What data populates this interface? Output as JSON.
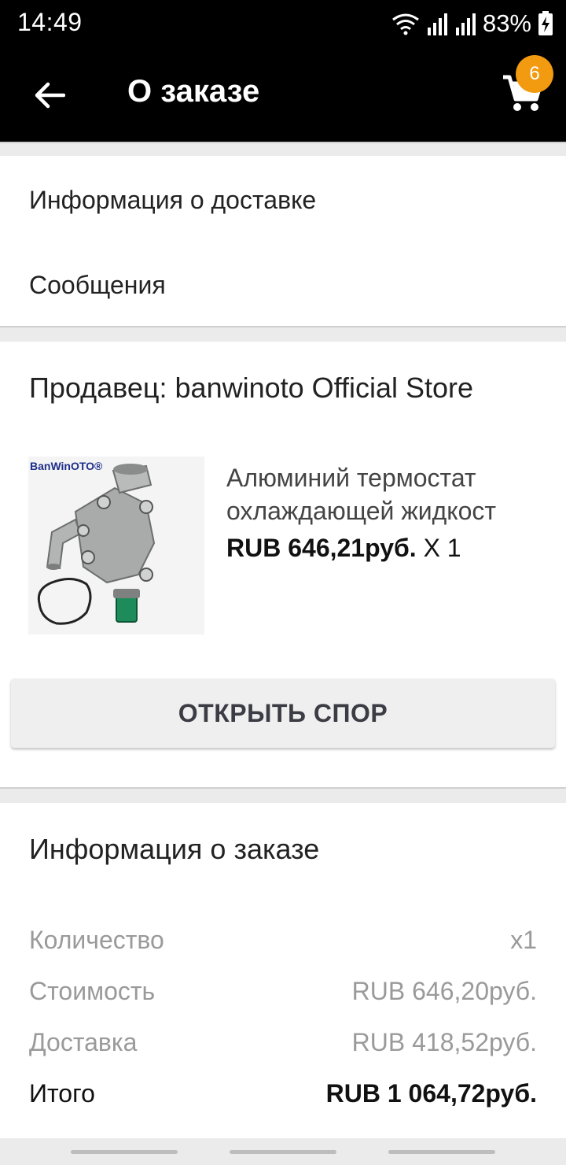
{
  "status_bar": {
    "time": "14:49",
    "battery": "83%",
    "icons": [
      "wifi-icon",
      "signal-icon",
      "signal-icon",
      "battery-charging-icon"
    ]
  },
  "app_bar": {
    "title": "О заказе",
    "back_icon": "arrow-left-icon",
    "cart_icon": "cart-icon",
    "cart_count": "6",
    "badge_color": "#f29a10"
  },
  "links": {
    "delivery_info": "Информация о доставке",
    "messages": "Сообщения"
  },
  "seller": {
    "label": "Продавец: banwinoto Official Store",
    "product": {
      "image_brand": "BanWinOTO®",
      "title_line1": "Алюминий термостат",
      "title_line2": "охлаждающей жидкост",
      "price": "RUB 646,21руб.",
      "quantity": "X 1"
    },
    "dispute_button": "ОТКРЫТЬ СПОР"
  },
  "order_info": {
    "title": "Информация о заказе",
    "rows": [
      {
        "label": "Количество",
        "value": "x1"
      },
      {
        "label": "Стоимость",
        "value": "RUB 646,20руб."
      },
      {
        "label": "Доставка",
        "value": "RUB 418,52руб."
      },
      {
        "label": "Итого",
        "value": "RUB 1 064,72руб."
      }
    ]
  }
}
